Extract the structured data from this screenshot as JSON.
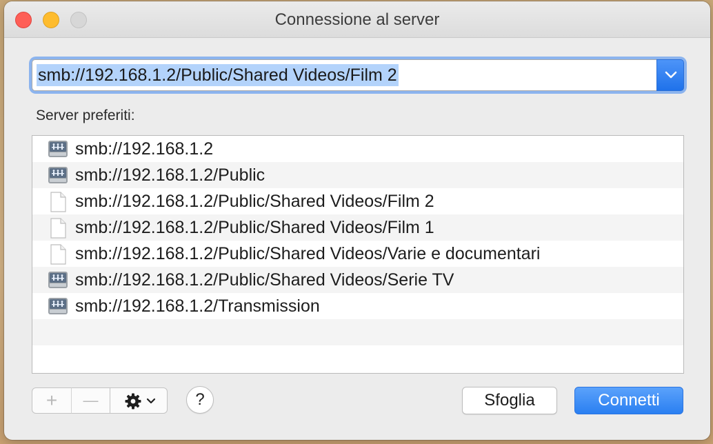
{
  "window": {
    "title": "Connessione al server"
  },
  "address": {
    "value": "smb://192.168.1.2/Public/Shared Videos/Film 2"
  },
  "favorites": {
    "label": "Server preferiti:",
    "items": [
      {
        "url": "smb://192.168.1.2",
        "icon": "server-icon"
      },
      {
        "url": "smb://192.168.1.2/Public",
        "icon": "server-icon"
      },
      {
        "url": "smb://192.168.1.2/Public/Shared Videos/Film 2",
        "icon": "document-icon"
      },
      {
        "url": "smb://192.168.1.2/Public/Shared Videos/Film 1",
        "icon": "document-icon"
      },
      {
        "url": "smb://192.168.1.2/Public/Shared Videos/Varie e documentari",
        "icon": "document-icon"
      },
      {
        "url": "smb://192.168.1.2/Public/Shared Videos/Serie TV",
        "icon": "server-icon"
      },
      {
        "url": "smb://192.168.1.2/Transmission",
        "icon": "server-icon"
      }
    ]
  },
  "toolbar": {
    "add_glyph": "+",
    "remove_glyph": "—",
    "help_glyph": "?"
  },
  "buttons": {
    "browse_label": "Sfoglia",
    "connect_label": "Connetti"
  },
  "colors": {
    "accent": "#2a7ff1",
    "selection": "#b3d3fb"
  }
}
